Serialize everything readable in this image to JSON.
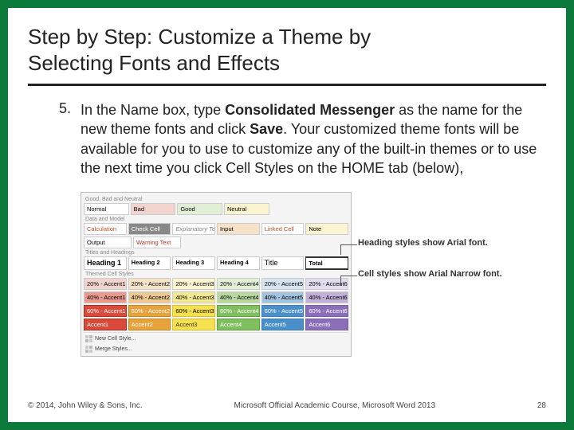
{
  "title_line1": "Step by Step: Customize a Theme by",
  "title_line2": "Selecting Fonts and Effects",
  "step_number": "5.",
  "step_parts": {
    "p1": "In the Name box, type ",
    "b1": "Consolidated Messenger",
    "p2": " as the name for the new theme fonts and click ",
    "b2": "Save",
    "p3": ". Your customized theme fonts will be available for you to use to customize any of the built-in themes or to use the next time you click Cell Styles on the HOME tab (below),"
  },
  "gallery": {
    "sec1": "Good, Bad and Neutral",
    "row1": [
      "Normal",
      "Bad",
      "Good",
      "Neutral"
    ],
    "sec2": "Data and Model",
    "row2a": [
      "Calculation",
      "Check Cell",
      "Explanatory Text",
      "Input",
      "Linked Cell",
      "Note"
    ],
    "row2b": [
      "Output",
      "Warning Text"
    ],
    "sec3": "Titles and Headings",
    "row3": [
      "Heading 1",
      "Heading 2",
      "Heading 3",
      "Heading 4",
      "Title",
      "Total"
    ],
    "sec4": "Themed Cell Styles",
    "row4a": [
      "20% - Accent1",
      "20% - Accent2",
      "20% - Accent3",
      "20% - Accent4",
      "20% - Accent5",
      "20% - Accent6"
    ],
    "row4b": [
      "40% - Accent1",
      "40% - Accent2",
      "40% - Accent3",
      "40% - Accent4",
      "40% - Accent5",
      "40% - Accent6"
    ],
    "row4c": [
      "60% - Accent1",
      "60% - Accent2",
      "60% - Accent3",
      "60% - Accent4",
      "60% - Accent5",
      "60% - Accent6"
    ],
    "row4d": [
      "Accent1",
      "Accent2",
      "Accent3",
      "Accent4",
      "Accent5",
      "Accent6"
    ],
    "menu1": "New Cell Style...",
    "menu2": "Merge Styles..."
  },
  "callout1": "Heading styles show Arial font.",
  "callout2": "Cell styles show Arial Narrow font.",
  "footer_left": "© 2014, John Wiley & Sons, Inc.",
  "footer_center": "Microsoft Official Academic Course, Microsoft Word 2013",
  "footer_page": "28"
}
